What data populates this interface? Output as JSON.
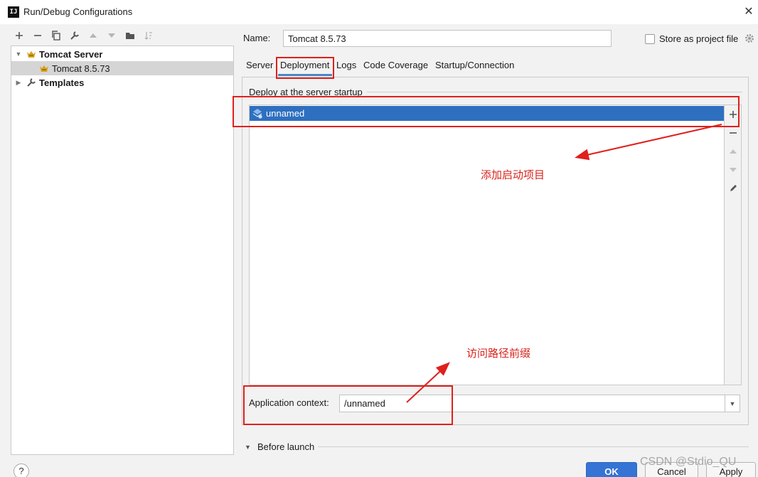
{
  "window": {
    "title": "Run/Debug Configurations",
    "app_icon_text": "IJ"
  },
  "toolbar": {
    "buttons": [
      "add-icon",
      "remove-icon",
      "copy-icon",
      "wrench-icon",
      "move-up-icon",
      "move-down-icon",
      "new-folder-icon",
      "sort-icon"
    ]
  },
  "tree": {
    "items": [
      {
        "label": "Tomcat Server",
        "bold": true,
        "expanded": true
      },
      {
        "label": "Tomcat 8.5.73",
        "bold": false,
        "selected": true
      },
      {
        "label": "Templates",
        "bold": true,
        "expanded": false
      }
    ]
  },
  "name_field": {
    "label": "Name:",
    "value": "Tomcat 8.5.73"
  },
  "store_as_project": {
    "label": "Store as project file",
    "checked": false
  },
  "tabs": [
    {
      "label": "Server"
    },
    {
      "label": "Deployment",
      "active": true
    },
    {
      "label": "Logs"
    },
    {
      "label": "Code Coverage"
    },
    {
      "label": "Startup/Connection"
    }
  ],
  "deployment": {
    "section_title": "Deploy at the server startup",
    "items": [
      {
        "label": "unnamed",
        "selected": true
      }
    ],
    "side_buttons": [
      "add-icon",
      "remove-icon",
      "move-up-icon",
      "move-down-icon",
      "edit-icon"
    ]
  },
  "app_context": {
    "label": "Application context:",
    "value": "/unnamed"
  },
  "before_launch": {
    "label": "Before launch"
  },
  "buttons": {
    "help": "?",
    "ok": "OK",
    "cancel": "Cancel",
    "apply": "Apply"
  },
  "annotations": {
    "add_project": "添加启动项目",
    "path_prefix": "访问路径前缀",
    "color": "#e0201c"
  },
  "watermark": "CSDN @Stdio_QU",
  "colors": {
    "selection": "#2e6fc0",
    "tab_underline": "#4a88c7",
    "ok_button": "#3574d4"
  }
}
